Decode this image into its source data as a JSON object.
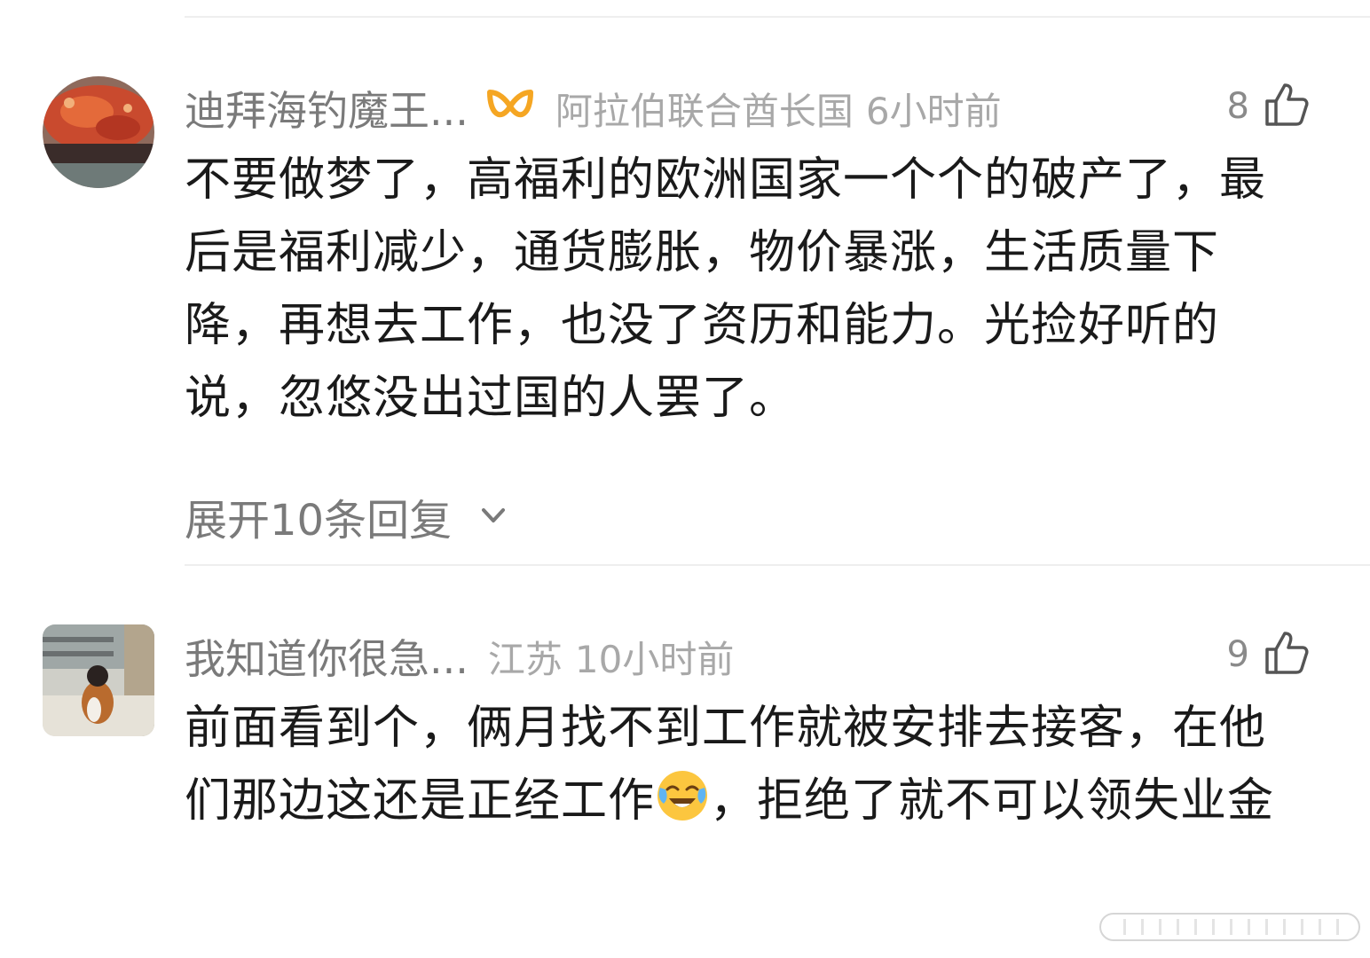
{
  "comments": [
    {
      "username": "迪拜海钓魔王...",
      "badge_icon": "vip-badge-icon",
      "location": "阿拉伯联合酋长国",
      "time": "6小时前",
      "likes": "8",
      "text": "不要做梦了，高福利的欧洲国家一个个的破产了，最后是福利减少，通货膨胀，物价暴涨，生活质量下降，再想去工作，也没了资历和能力。光捡好听的说，忽悠没出过国的人罢了。",
      "expand_label": "展开10条回复"
    },
    {
      "username": "我知道你很急...",
      "location": "江苏",
      "time": "10小时前",
      "likes": "9",
      "text_before_emoji": "前面看到个，俩月找不到工作就被安排去接客，在他们那边这还是正经工作",
      "emoji": "crying-laughing-emoji-icon",
      "text_after_emoji": "，拒绝了就不可以领失业金"
    }
  ],
  "colors": {
    "username": "#7a7a7a",
    "meta": "#a8a8a8",
    "body": "#1a1a1a",
    "badge": "#f5a623"
  }
}
